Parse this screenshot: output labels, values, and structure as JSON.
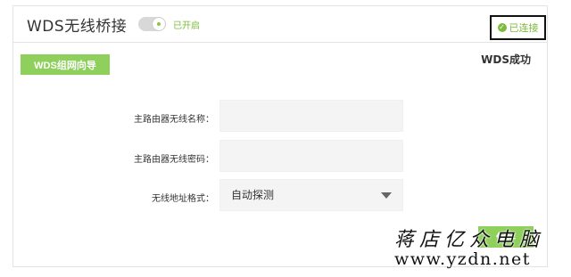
{
  "header": {
    "title": "WDS无线桥接",
    "toggle_status": "已开启",
    "connection_status": "已连接"
  },
  "wizard_button_label": "WDS组网向导",
  "wds_status": "WDS成功",
  "form": {
    "ssid_label": "主路由器无线名称：",
    "ssid_value": "",
    "password_label": "主路由器无线密码：",
    "password_value": "",
    "address_format_label": "无线地址格式：",
    "address_format_value": "自动探测"
  },
  "save_button_label": "保存",
  "watermark": {
    "line1": "蒋店亿众电脑",
    "line2": "www.yzdn.net"
  },
  "colors": {
    "accent_green": "#8fcf5b",
    "status_green": "#7dbb3c",
    "input_bg": "#f4f4f4"
  },
  "icons": {
    "toggle": "toggle-switch-icon",
    "connected": "check-circle-icon",
    "dropdown": "triangle-down-icon"
  }
}
